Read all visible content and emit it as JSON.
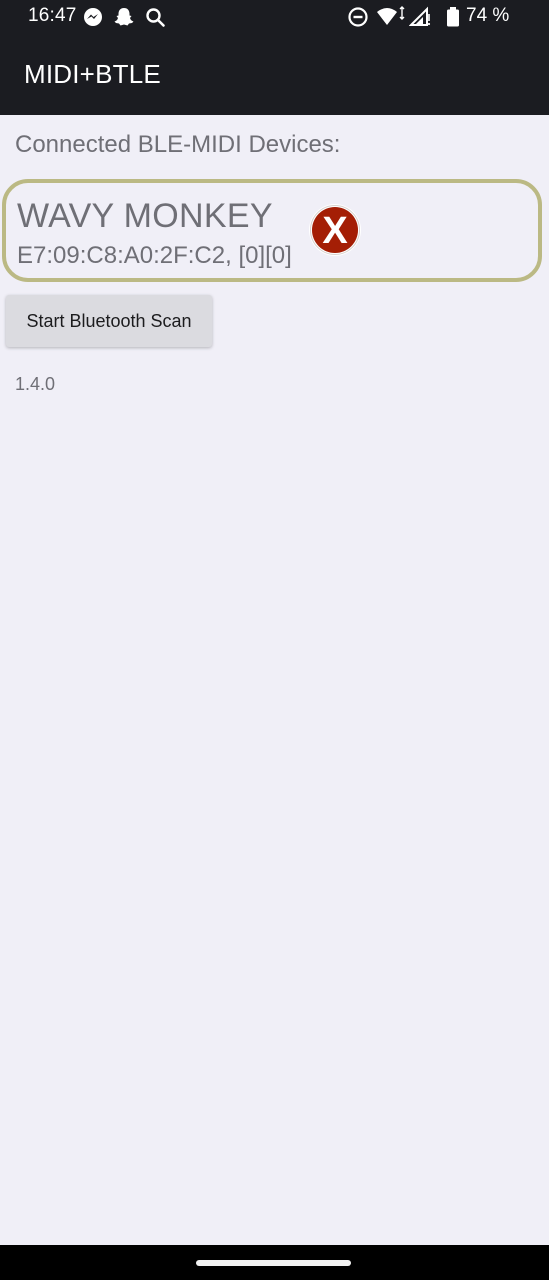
{
  "status_bar": {
    "time": "16:47",
    "battery_percent": "74 %",
    "left_icons": [
      "messenger-icon",
      "snapchat-icon",
      "search-icon"
    ],
    "right_icons": [
      "do-not-disturb-icon",
      "wifi-icon",
      "signal-icon",
      "battery-icon"
    ]
  },
  "app_bar": {
    "title": "MIDI+BTLE"
  },
  "main": {
    "heading": "Connected BLE-MIDI Devices:",
    "device": {
      "name": "WAVY MONKEY",
      "address": "E7:09:C8:A0:2F:C2, [0][0]",
      "disconnect_glyph": "X"
    },
    "scan_button_label": "Start Bluetooth Scan",
    "version": "1.4.0"
  },
  "colors": {
    "bar_background": "#1b1c21",
    "page_background": "#f0eff7",
    "card_border": "#bbb984",
    "disconnect_red": "#a41e05",
    "text_gray": "#6f6f76"
  }
}
